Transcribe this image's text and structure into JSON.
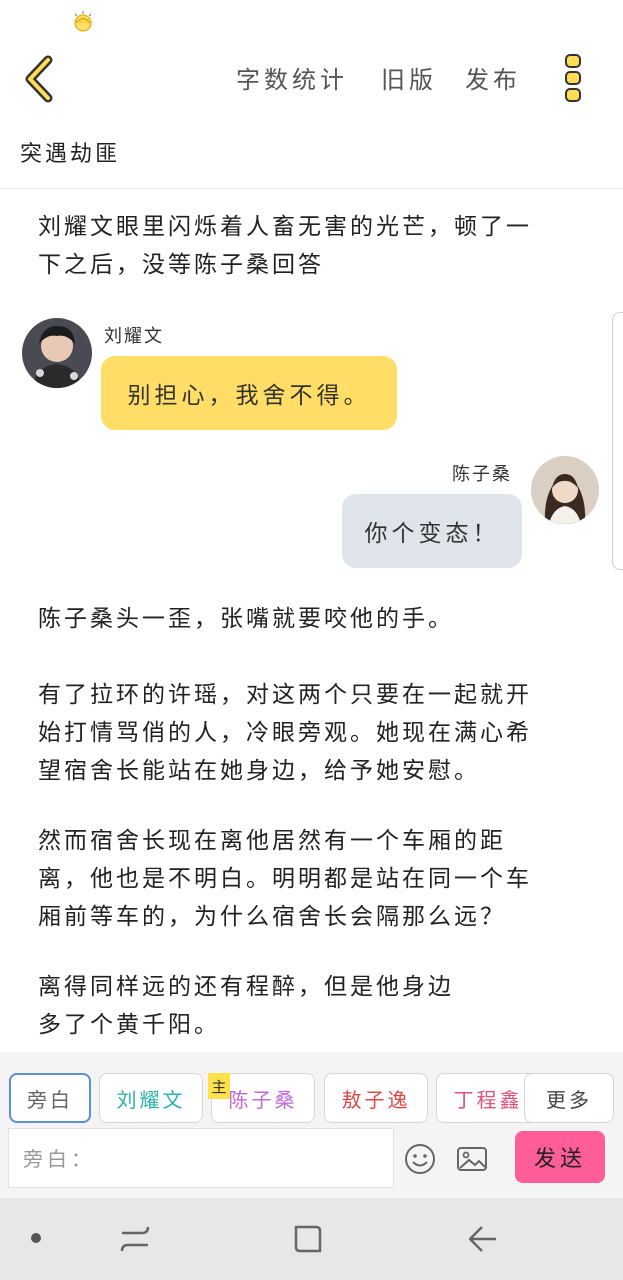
{
  "topbar": {
    "actions": [
      "字数统计",
      "旧版",
      "发布"
    ]
  },
  "chapter": {
    "title": "突遇劫匪"
  },
  "content": {
    "narration_1": [
      "刘耀文眼里闪烁着人畜无害的光芒，顿了一",
      "下之后，没等陈子桑回答"
    ],
    "msg_left": {
      "speaker": "刘耀文",
      "text": "别担心，我舍不得。"
    },
    "msg_right": {
      "speaker": "陈子桑",
      "text": "你个变态！"
    },
    "narration_2": [
      "陈子桑头一歪，张嘴就要咬他的手。"
    ],
    "narration_3": [
      "有了拉环的许瑶，对这两个只要在一起就开",
      "始打情骂俏的人，冷眼旁观。她现在满心希",
      "望宿舍长能站在她身边，给予她安慰。"
    ],
    "narration_4": [
      "然而宿舍长现在离他居然有一个车厢的距",
      "离，他也是不明白。明明都是站在同一个车",
      "厢前等车的，为什么宿舍长会隔那么远？"
    ],
    "narration_5": [
      "离得同样远的还有程醉，但是他身边",
      "多了个黄千阳。"
    ]
  },
  "composer": {
    "roles": [
      {
        "label": "旁白",
        "color": "#666666"
      },
      {
        "label": "刘耀文",
        "color": "#2ab3a8"
      },
      {
        "label": "陈子桑",
        "color": "#c06ad8"
      },
      {
        "label": "敖子逸",
        "color": "#e04848"
      },
      {
        "label": "丁程鑫",
        "color": "#e0507a"
      },
      {
        "label": "更多",
        "color": "#444444"
      }
    ],
    "main_badge": "主",
    "input_placeholder": "旁白：",
    "send_label": "发送"
  },
  "colors": {
    "accent_yellow": "#ffdd66",
    "bubble_right": "#dfe3ea",
    "send_pink": "#ff5d97",
    "selected_tab_border": "#5b8fd6"
  },
  "icons": [
    "sun-umbrella-icon",
    "back-chevron-icon",
    "more-vertical-icon",
    "emoji-icon",
    "image-icon",
    "nav-dot-icon",
    "recent-apps-icon",
    "home-icon",
    "nav-back-icon"
  ]
}
